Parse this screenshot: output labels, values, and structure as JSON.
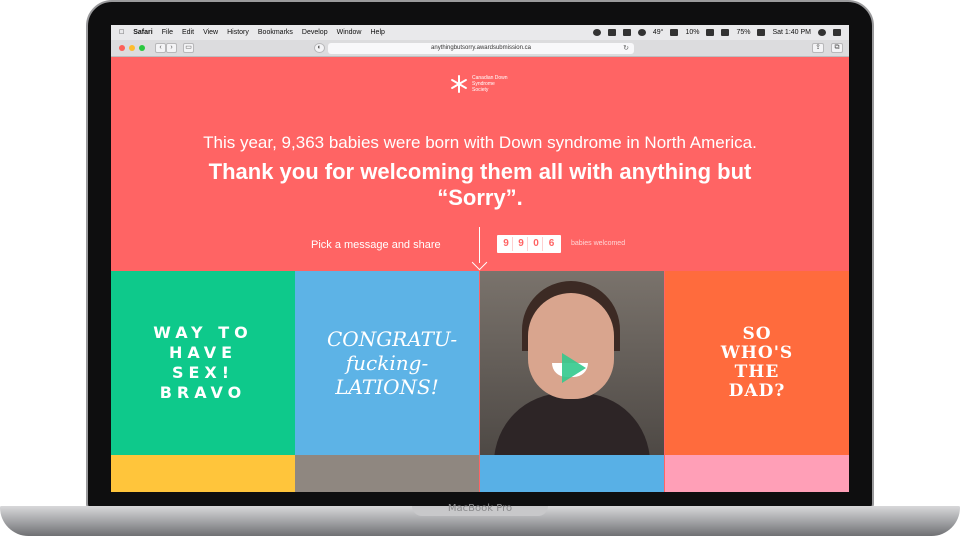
{
  "device_label": "MacBook Pro",
  "menubar": {
    "items": [
      "Safari",
      "File",
      "Edit",
      "View",
      "History",
      "Bookmarks",
      "Develop",
      "Window",
      "Help"
    ],
    "temperature": "49°",
    "battery_a": "10%",
    "battery_b": "75%",
    "clock": "Sat 1:40 PM"
  },
  "browser": {
    "url": "anythingbutsorry.awardsubmission.ca"
  },
  "page": {
    "logo_text": "Canadian Down Syndrome Society",
    "headline": "This year, 9,363 babies were born with Down syndrome in North America.",
    "subhead": "Thank you for welcoming them all with anything but “Sorry”.",
    "pick_label": "Pick a message and share",
    "counter_digits": [
      "9",
      "9",
      "0",
      "6"
    ],
    "counter_label": "babies welcomed",
    "tiles": [
      {
        "text": "WAY TO HAVE SEX! BRAVO"
      },
      {
        "text": "CONGRATU-fucking-LATIONS!"
      },
      {
        "text": ""
      },
      {
        "text": "SO WHO'S THE DAD?"
      }
    ]
  },
  "colors": {
    "brand": "#ff6464",
    "green": "#0ec98b",
    "blue": "#5db3e6",
    "orange": "#ff6b3d",
    "yellow": "#ffc53b",
    "pink": "#ff9fb7"
  }
}
